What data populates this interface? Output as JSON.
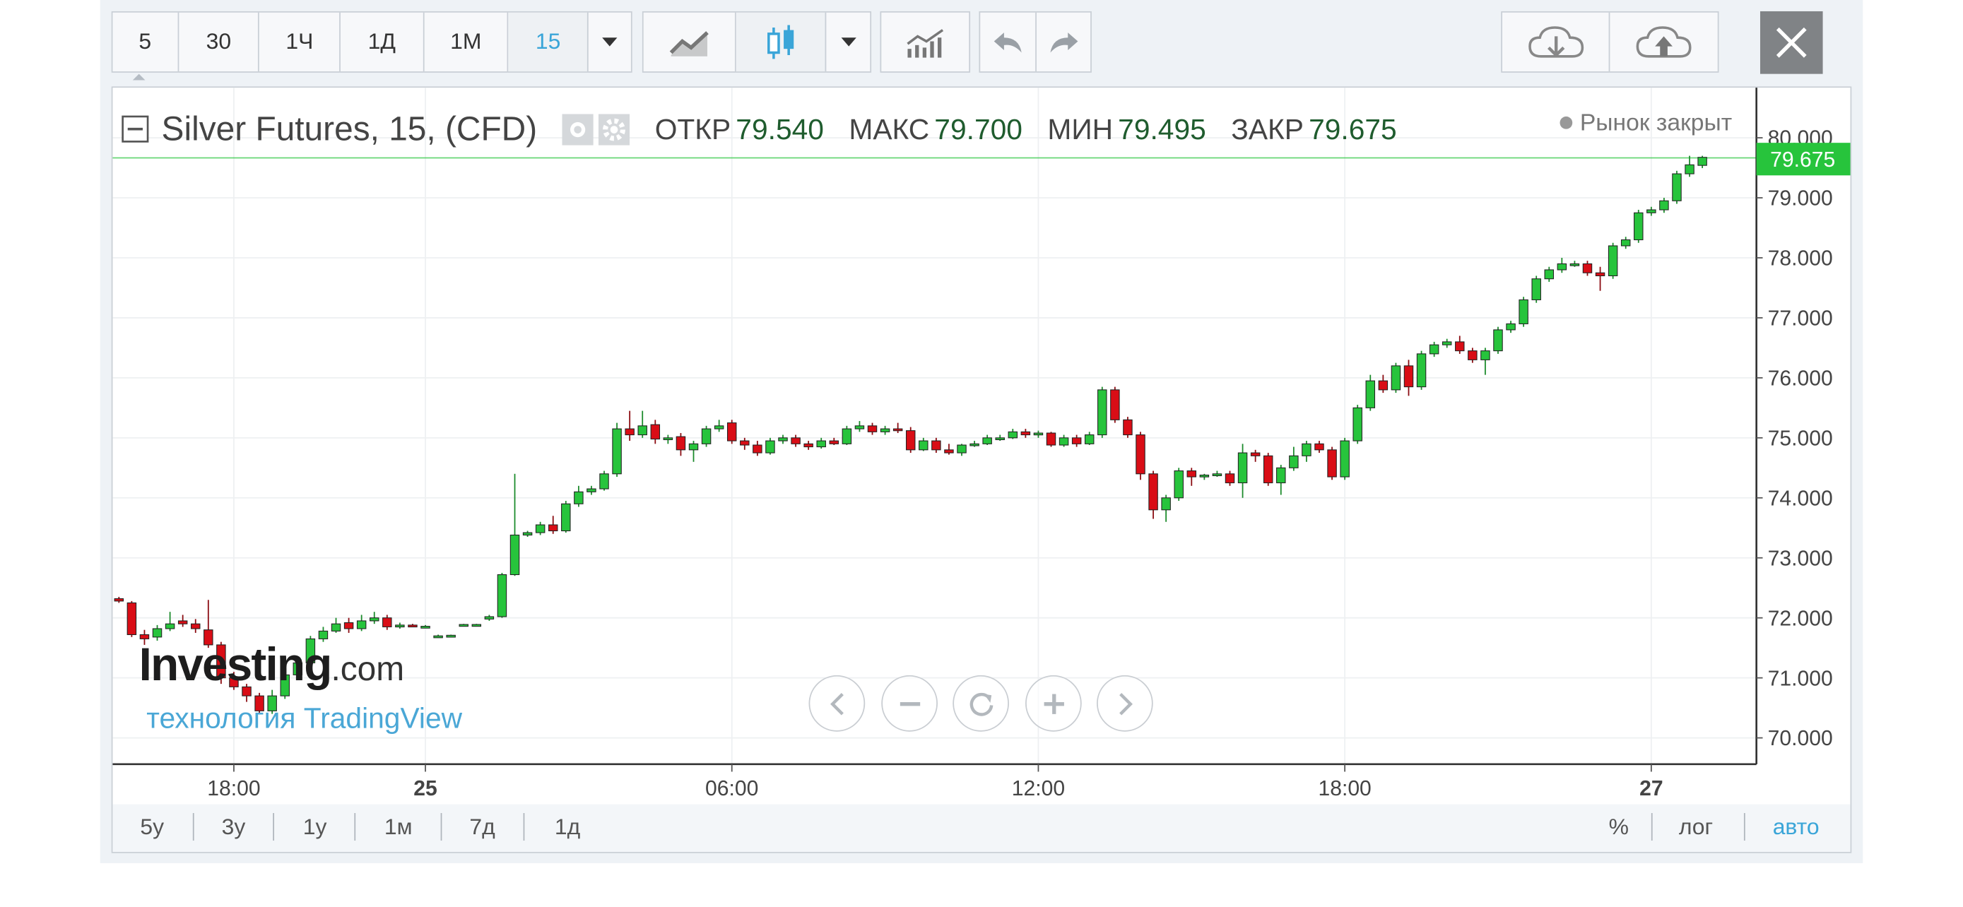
{
  "toolbar": {
    "intervals": [
      "5",
      "30",
      "1Ч",
      "1Д",
      "1М",
      "15"
    ],
    "active_interval": "15",
    "icons": [
      "dropdown-icon",
      "line-chart-icon",
      "candles-icon",
      "dropdown-icon",
      "indicators-icon",
      "undo-icon",
      "redo-icon",
      "cloud-download-icon",
      "cloud-upload-icon",
      "close-icon"
    ]
  },
  "legend": {
    "title": "Silver Futures, 15, (CFD)",
    "open_label": "ОТКР",
    "open_value": "79.540",
    "high_label": "МАКС",
    "high_value": "79.700",
    "low_label": "МИН",
    "low_value": "79.495",
    "close_label": "ЗАКР",
    "close_value": "79.675"
  },
  "status": "Рынок закрыт",
  "watermark": {
    "brand": "Investing",
    "brand_suffix": ".com",
    "tech": "технология TradingView"
  },
  "ranges": [
    "5у",
    "3у",
    "1у",
    "1м",
    "7д",
    "1д"
  ],
  "scale_buttons": [
    "%",
    "лог",
    "авто"
  ],
  "active_scale": "авто",
  "colors": {
    "up": "#27c43c",
    "down": "#d90d16",
    "accent": "#3aa5d8",
    "last_price": "#27c43c"
  },
  "chart_data": {
    "type": "candlestick",
    "title": "Silver Futures, 15, (CFD)",
    "ylim": [
      69.6,
      80.45
    ],
    "y_ticks": [
      "70.000",
      "71.000",
      "72.000",
      "73.000",
      "74.000",
      "75.000",
      "76.000",
      "77.000",
      "78.000",
      "79.000",
      "80.000"
    ],
    "x_ticks": [
      {
        "label": "18:00",
        "index": 9,
        "bold": false
      },
      {
        "label": "25",
        "index": 24,
        "bold": true
      },
      {
        "label": "06:00",
        "index": 48,
        "bold": false
      },
      {
        "label": "12:00",
        "index": 72,
        "bold": false
      },
      {
        "label": "18:00",
        "index": 96,
        "bold": false
      },
      {
        "label": "27",
        "index": 120,
        "bold": true
      }
    ],
    "last_price": "79.675",
    "candles": [
      [
        72.32,
        72.28,
        72.35,
        72.25
      ],
      [
        72.25,
        71.72,
        72.28,
        71.68
      ],
      [
        71.72,
        71.65,
        71.8,
        71.55
      ],
      [
        71.68,
        71.82,
        71.88,
        71.62
      ],
      [
        71.82,
        71.9,
        72.1,
        71.78
      ],
      [
        71.95,
        71.9,
        72.05,
        71.85
      ],
      [
        71.9,
        71.82,
        71.98,
        71.75
      ],
      [
        71.8,
        71.55,
        72.3,
        71.5
      ],
      [
        71.55,
        71.0,
        71.6,
        70.9
      ],
      [
        71.0,
        70.85,
        71.1,
        70.8
      ],
      [
        70.85,
        70.7,
        70.9,
        70.6
      ],
      [
        70.7,
        70.45,
        70.75,
        70.4
      ],
      [
        70.45,
        70.7,
        70.8,
        70.4
      ],
      [
        70.7,
        71.05,
        71.1,
        70.65
      ],
      [
        71.05,
        71.25,
        71.3,
        71.0
      ],
      [
        71.25,
        71.65,
        71.7,
        71.2
      ],
      [
        71.65,
        71.78,
        71.85,
        71.6
      ],
      [
        71.78,
        71.9,
        72.0,
        71.75
      ],
      [
        71.92,
        71.82,
        72.0,
        71.75
      ],
      [
        71.82,
        71.95,
        72.05,
        71.78
      ],
      [
        71.95,
        72.0,
        72.1,
        71.9
      ],
      [
        72.0,
        71.85,
        72.05,
        71.8
      ],
      [
        71.85,
        71.88,
        71.92,
        71.82
      ],
      [
        71.88,
        71.87,
        71.9,
        71.85
      ],
      [
        71.85,
        71.86,
        71.88,
        71.84
      ],
      [
        71.7,
        71.7,
        71.72,
        71.68
      ],
      [
        71.7,
        71.71,
        71.72,
        71.69
      ],
      [
        71.88,
        71.89,
        71.9,
        71.86
      ],
      [
        71.89,
        71.89,
        71.9,
        71.88
      ],
      [
        71.98,
        72.02,
        72.05,
        71.95
      ],
      [
        72.02,
        72.72,
        72.75,
        72.0
      ],
      [
        72.72,
        73.38,
        74.4,
        72.7
      ],
      [
        73.38,
        73.42,
        73.45,
        73.35
      ],
      [
        73.42,
        73.55,
        73.6,
        73.38
      ],
      [
        73.55,
        73.45,
        73.7,
        73.4
      ],
      [
        73.45,
        73.9,
        73.95,
        73.42
      ],
      [
        73.9,
        74.1,
        74.2,
        73.85
      ],
      [
        74.1,
        74.15,
        74.2,
        74.05
      ],
      [
        74.15,
        74.4,
        74.45,
        74.12
      ],
      [
        74.4,
        75.15,
        75.25,
        74.35
      ],
      [
        75.15,
        75.05,
        75.45,
        74.95
      ],
      [
        75.05,
        75.2,
        75.45,
        75.0
      ],
      [
        75.22,
        74.98,
        75.3,
        74.9
      ],
      [
        74.98,
        75.0,
        75.05,
        74.9
      ],
      [
        75.02,
        74.8,
        75.08,
        74.7
      ],
      [
        74.8,
        74.9,
        74.95,
        74.6
      ],
      [
        74.9,
        75.15,
        75.2,
        74.85
      ],
      [
        75.15,
        75.2,
        75.3,
        75.1
      ],
      [
        75.25,
        74.95,
        75.3,
        74.9
      ],
      [
        74.95,
        74.88,
        75.0,
        74.8
      ],
      [
        74.88,
        74.75,
        74.95,
        74.7
      ],
      [
        74.75,
        74.95,
        75.0,
        74.72
      ],
      [
        74.95,
        75.0,
        75.05,
        74.9
      ],
      [
        75.0,
        74.9,
        75.05,
        74.85
      ],
      [
        74.9,
        74.85,
        74.95,
        74.8
      ],
      [
        74.85,
        74.95,
        75.0,
        74.82
      ],
      [
        74.95,
        74.9,
        75.0,
        74.88
      ],
      [
        74.9,
        75.15,
        75.2,
        74.88
      ],
      [
        75.15,
        75.2,
        75.28,
        75.1
      ],
      [
        75.2,
        75.1,
        75.25,
        75.05
      ],
      [
        75.1,
        75.15,
        75.2,
        75.05
      ],
      [
        75.15,
        75.12,
        75.25,
        75.08
      ],
      [
        75.12,
        74.8,
        75.18,
        74.75
      ],
      [
        74.8,
        74.95,
        75.0,
        74.78
      ],
      [
        74.95,
        74.8,
        75.0,
        74.75
      ],
      [
        74.8,
        74.75,
        74.9,
        74.72
      ],
      [
        74.75,
        74.88,
        74.9,
        74.7
      ],
      [
        74.88,
        74.9,
        74.95,
        74.85
      ],
      [
        74.9,
        75.0,
        75.05,
        74.88
      ],
      [
        75.0,
        75.0,
        75.05,
        74.95
      ],
      [
        75.0,
        75.1,
        75.15,
        74.98
      ],
      [
        75.1,
        75.05,
        75.15,
        75.0
      ],
      [
        75.05,
        75.08,
        75.12,
        75.0
      ],
      [
        75.08,
        74.88,
        75.1,
        74.85
      ],
      [
        74.88,
        75.0,
        75.05,
        74.85
      ],
      [
        75.0,
        74.9,
        75.05,
        74.85
      ],
      [
        74.9,
        75.05,
        75.1,
        74.88
      ],
      [
        75.05,
        75.8,
        75.85,
        75.0
      ],
      [
        75.8,
        75.3,
        75.85,
        75.25
      ],
      [
        75.3,
        75.05,
        75.35,
        75.0
      ],
      [
        75.05,
        74.4,
        75.1,
        74.3
      ],
      [
        74.4,
        73.8,
        74.45,
        73.65
      ],
      [
        73.8,
        74.0,
        74.05,
        73.6
      ],
      [
        74.0,
        74.45,
        74.5,
        73.95
      ],
      [
        74.45,
        74.35,
        74.5,
        74.2
      ],
      [
        74.35,
        74.38,
        74.4,
        74.3
      ],
      [
        74.38,
        74.4,
        74.45,
        74.35
      ],
      [
        74.4,
        74.25,
        74.45,
        74.2
      ],
      [
        74.25,
        74.75,
        74.9,
        74.0
      ],
      [
        74.75,
        74.7,
        74.8,
        74.6
      ],
      [
        74.7,
        74.25,
        74.75,
        74.2
      ],
      [
        74.25,
        74.5,
        74.55,
        74.05
      ],
      [
        74.5,
        74.7,
        74.85,
        74.45
      ],
      [
        74.7,
        74.9,
        74.95,
        74.6
      ],
      [
        74.9,
        74.8,
        74.95,
        74.75
      ],
      [
        74.8,
        74.35,
        74.85,
        74.3
      ],
      [
        74.35,
        74.95,
        75.0,
        74.3
      ],
      [
        74.95,
        75.5,
        75.55,
        74.9
      ],
      [
        75.5,
        75.95,
        76.05,
        75.45
      ],
      [
        75.95,
        75.8,
        76.05,
        75.75
      ],
      [
        75.8,
        76.2,
        76.25,
        75.75
      ],
      [
        76.2,
        75.85,
        76.3,
        75.7
      ],
      [
        75.85,
        76.4,
        76.45,
        75.8
      ],
      [
        76.4,
        76.55,
        76.6,
        76.35
      ],
      [
        76.55,
        76.6,
        76.65,
        76.5
      ],
      [
        76.6,
        76.45,
        76.7,
        76.4
      ],
      [
        76.45,
        76.3,
        76.5,
        76.25
      ],
      [
        76.3,
        76.45,
        76.5,
        76.05
      ],
      [
        76.45,
        76.8,
        76.85,
        76.4
      ],
      [
        76.8,
        76.9,
        76.95,
        76.75
      ],
      [
        76.9,
        77.3,
        77.35,
        76.85
      ],
      [
        77.3,
        77.65,
        77.7,
        77.25
      ],
      [
        77.65,
        77.8,
        77.85,
        77.6
      ],
      [
        77.8,
        77.9,
        78.0,
        77.75
      ],
      [
        77.9,
        77.9,
        77.95,
        77.85
      ],
      [
        77.9,
        77.75,
        77.95,
        77.7
      ],
      [
        77.75,
        77.7,
        77.85,
        77.45
      ],
      [
        77.7,
        78.2,
        78.25,
        77.65
      ],
      [
        78.2,
        78.3,
        78.35,
        78.15
      ],
      [
        78.3,
        78.75,
        78.8,
        78.25
      ],
      [
        78.75,
        78.8,
        78.85,
        78.7
      ],
      [
        78.8,
        78.95,
        79.0,
        78.75
      ],
      [
        78.95,
        79.4,
        79.45,
        78.9
      ],
      [
        79.4,
        79.55,
        79.7,
        79.35
      ],
      [
        79.54,
        79.675,
        79.7,
        79.495
      ]
    ]
  }
}
